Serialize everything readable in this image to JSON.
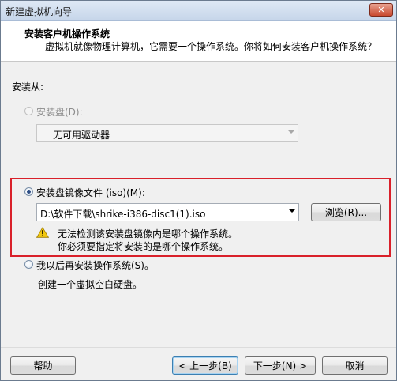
{
  "window": {
    "title": "新建虚拟机向导",
    "close_glyph": "✕"
  },
  "header": {
    "title": "安装客户机操作系统",
    "subtitle": "虚拟机就像物理计算机，它需要一个操作系统。你将如何安装客户机操作系统？"
  },
  "install_from_label": "安装从:",
  "options": {
    "disc": {
      "label": "安装盘(D):",
      "selected": false,
      "enabled": false,
      "combo_value": "无可用驱动器"
    },
    "iso": {
      "label": "安装盘镜像文件 (iso)(M):",
      "selected": true,
      "enabled": true,
      "combo_value": "D:\\软件下载\\shrike-i386-disc1(1).iso",
      "browse_label": "浏览(R)...",
      "warning_line1": "无法检测该安装盘镜像内是哪个操作系统。",
      "warning_line2": "你必须要指定将安装的是哪个操作系统。",
      "warning_icon": "warning-triangle-icon"
    },
    "later": {
      "label": "我以后再安装操作系统(S)。",
      "selected": false,
      "enabled": true,
      "description": "创建一个虚拟空白硬盘。"
    }
  },
  "buttons": {
    "help": "帮助",
    "back": "< 上一步(B)",
    "next": "下一步(N) >",
    "cancel": "取消"
  },
  "colors": {
    "highlight_border": "#d9202a",
    "warning_fill": "#f2c811"
  }
}
